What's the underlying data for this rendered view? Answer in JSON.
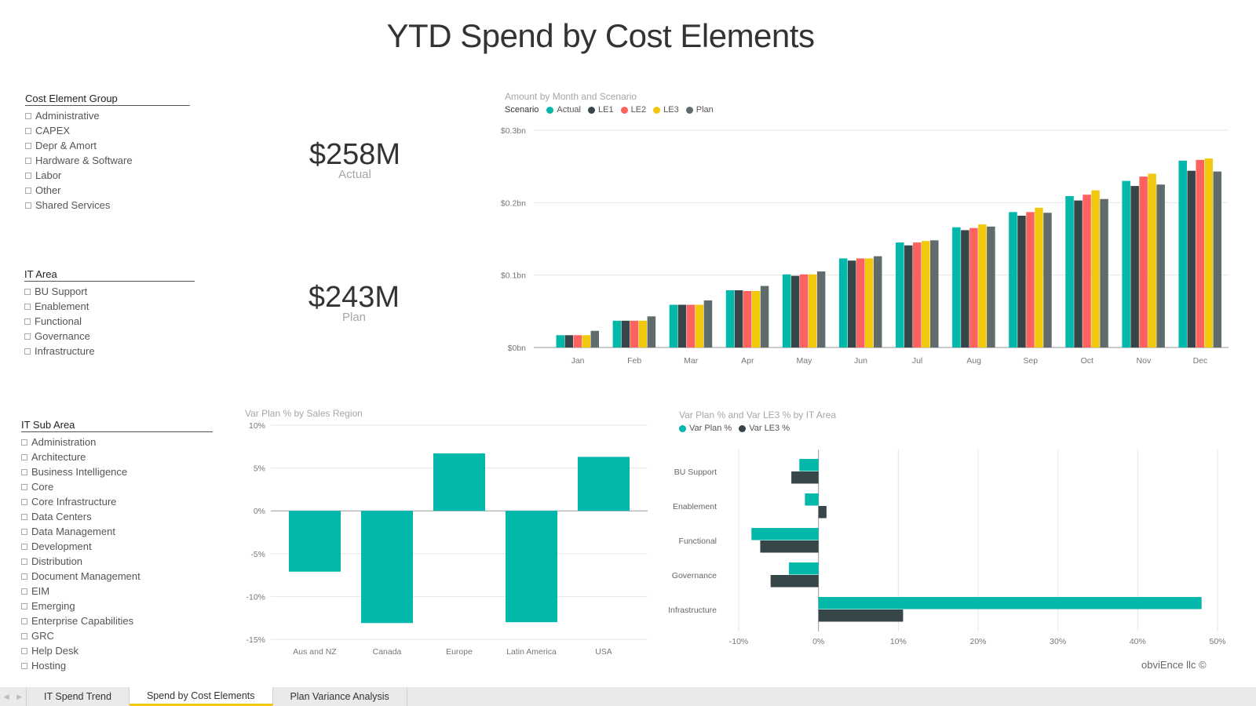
{
  "page": {
    "title": "YTD Spend by Cost Elements",
    "copyright": "obviEnce llc ©"
  },
  "slicers": {
    "cost_element_group": {
      "title": "Cost Element Group",
      "items": [
        "Administrative",
        "CAPEX",
        "Depr & Amort",
        "Hardware & Software",
        "Labor",
        "Other",
        "Shared Services"
      ]
    },
    "it_area": {
      "title": "IT Area",
      "items": [
        "BU Support",
        "Enablement",
        "Functional",
        "Governance",
        "Infrastructure"
      ]
    },
    "it_sub_area": {
      "title": "IT Sub Area",
      "items": [
        "Administration",
        "Architecture",
        "Business Intelligence",
        "Core",
        "Core Infrastructure",
        "Data Centers",
        "Data Management",
        "Development",
        "Distribution",
        "Document Management",
        "EIM",
        "Emerging",
        "Enterprise Capabilities",
        "GRC",
        "Help Desk",
        "Hosting"
      ]
    }
  },
  "kpis": [
    {
      "value": "$258M",
      "label": "Actual"
    },
    {
      "value": "$243M",
      "label": "Plan"
    }
  ],
  "tabs": {
    "nav_prev": "◀",
    "nav_next": "▶",
    "items": [
      {
        "label": "IT Spend Trend",
        "active": false
      },
      {
        "label": "Spend by Cost Elements",
        "active": true
      },
      {
        "label": "Plan Variance Analysis",
        "active": false
      }
    ]
  },
  "chart_data": [
    {
      "type": "bar",
      "title": "Amount by Month and Scenario",
      "legend_title": "Scenario",
      "legend_position": "top-left",
      "categories": [
        "Jan",
        "Feb",
        "Mar",
        "Apr",
        "May",
        "Jun",
        "Jul",
        "Aug",
        "Sep",
        "Oct",
        "Nov",
        "Dec"
      ],
      "series": [
        {
          "name": "Actual",
          "color": "#01b8aa",
          "values": [
            0.017,
            0.037,
            0.059,
            0.079,
            0.101,
            0.123,
            0.145,
            0.166,
            0.187,
            0.209,
            0.23,
            0.258
          ]
        },
        {
          "name": "LE1",
          "color": "#374649",
          "values": [
            0.017,
            0.037,
            0.059,
            0.079,
            0.099,
            0.12,
            0.141,
            0.162,
            0.182,
            0.203,
            0.223,
            0.244
          ]
        },
        {
          "name": "LE2",
          "color": "#fd625e",
          "values": [
            0.017,
            0.037,
            0.059,
            0.078,
            0.101,
            0.123,
            0.145,
            0.165,
            0.187,
            0.211,
            0.236,
            0.259
          ]
        },
        {
          "name": "LE3",
          "color": "#f2c80f",
          "values": [
            0.017,
            0.037,
            0.059,
            0.078,
            0.101,
            0.123,
            0.147,
            0.17,
            0.193,
            0.217,
            0.24,
            0.261
          ]
        },
        {
          "name": "Plan",
          "color": "#5f6b6d",
          "values": [
            0.023,
            0.043,
            0.065,
            0.085,
            0.105,
            0.126,
            0.148,
            0.167,
            0.186,
            0.205,
            0.225,
            0.243
          ]
        }
      ],
      "ylim": [
        0,
        0.3
      ],
      "yticks": [
        0,
        0.1,
        0.2,
        0.3
      ],
      "ytick_labels": [
        "$0bn",
        "$0.1bn",
        "$0.2bn",
        "$0.3bn"
      ],
      "xlabel": "",
      "ylabel": "",
      "grid": true
    },
    {
      "type": "bar",
      "title": "Var Plan % by Sales Region",
      "categories": [
        "Aus and NZ",
        "Canada",
        "Europe",
        "Latin America",
        "USA"
      ],
      "values": [
        -7.1,
        -13.1,
        6.7,
        -13.0,
        6.3
      ],
      "color": "#01b8aa",
      "ylim": [
        -15,
        10
      ],
      "yticks": [
        -15,
        -10,
        -5,
        0,
        5,
        10
      ],
      "ytick_labels": [
        "-15%",
        "-10%",
        "-5%",
        "0%",
        "5%",
        "10%"
      ],
      "xlabel": "",
      "ylabel": "",
      "grid": true
    },
    {
      "type": "bar",
      "orientation": "horizontal",
      "title": "Var Plan % and Var LE3 % by IT Area",
      "legend_position": "top-left",
      "categories": [
        "BU Support",
        "Enablement",
        "Functional",
        "Governance",
        "Infrastructure"
      ],
      "series": [
        {
          "name": "Var Plan %",
          "color": "#01b8aa",
          "values": [
            -2.4,
            -1.7,
            -8.4,
            -3.7,
            48.0
          ]
        },
        {
          "name": "Var LE3 %",
          "color": "#374649",
          "values": [
            -3.4,
            1.0,
            -7.3,
            -6.0,
            10.6
          ]
        }
      ],
      "xlim": [
        -10,
        50
      ],
      "xticks": [
        -10,
        0,
        10,
        20,
        30,
        40,
        50
      ],
      "xtick_labels": [
        "-10%",
        "0%",
        "10%",
        "20%",
        "30%",
        "40%",
        "50%"
      ],
      "xlabel": "",
      "ylabel": "",
      "grid": true
    }
  ]
}
